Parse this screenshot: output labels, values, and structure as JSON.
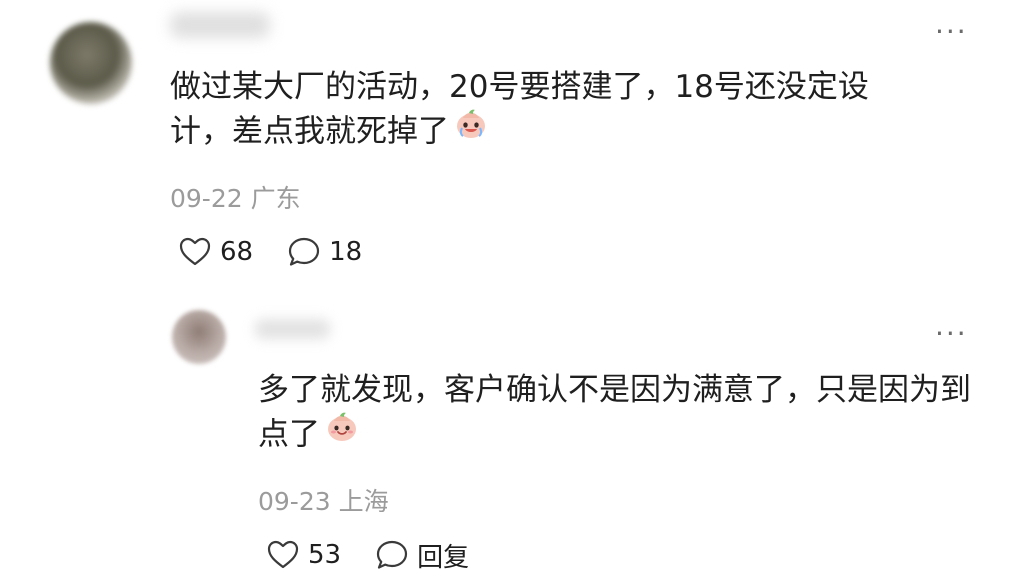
{
  "comments": [
    {
      "text": "做过某大厂的活动，20号要搭建了，18号还没定设计，差点我就死掉了",
      "emoji": "crying-face-emoji",
      "date": "09-22",
      "location": "广东",
      "likes": "68",
      "replies": "18"
    }
  ],
  "replies": [
    {
      "text": "多了就发现，客户确认不是因为满意了，只是因为到点了",
      "emoji": "smiling-face-emoji",
      "date": "09-23",
      "location": "上海",
      "likes": "53",
      "reply_label": "回复"
    }
  ],
  "ui": {
    "more_glyph": "···"
  },
  "colors": {
    "text": "#1f1f1f",
    "meta": "#9b9b9b",
    "icon": "#3a3a3a"
  }
}
